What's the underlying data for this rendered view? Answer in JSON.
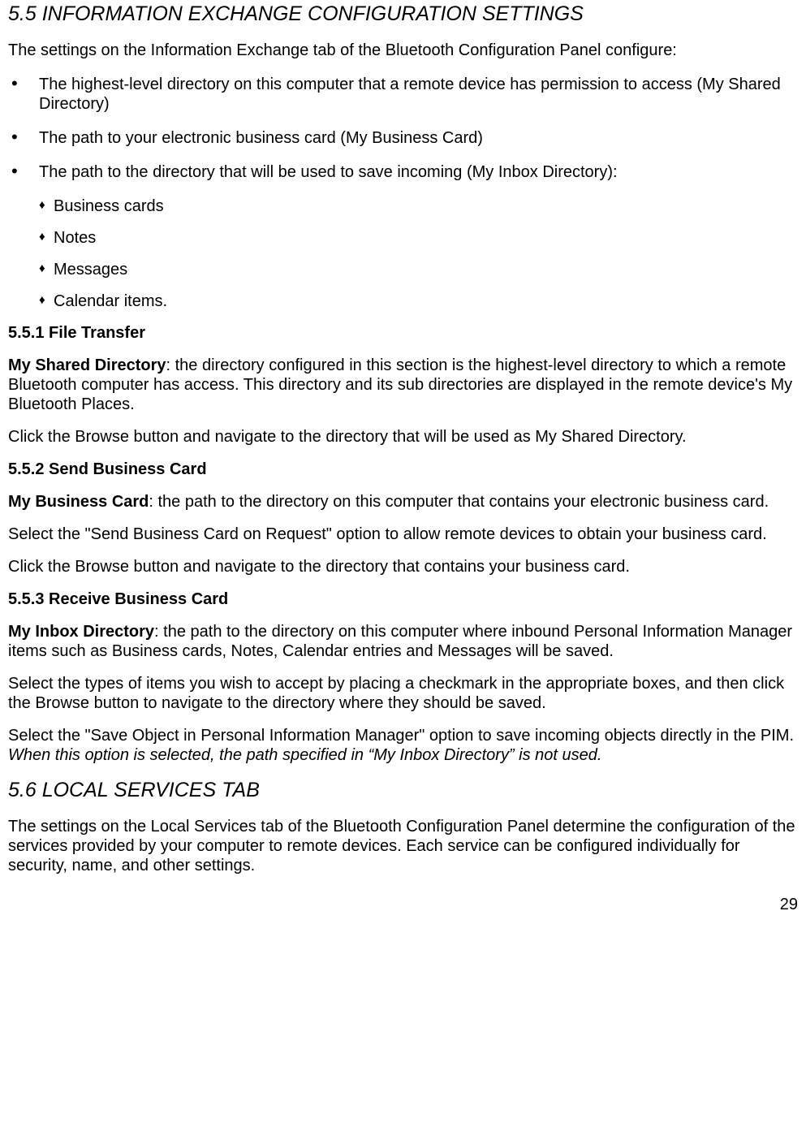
{
  "section55": {
    "heading": "5.5 INFORMATION EXCHANGE CONFIGURATION SETTINGS",
    "intro": "The settings on the Information Exchange tab of the Bluetooth Configuration Panel configure:",
    "bullets": [
      "The highest-level directory on this computer that a remote device has permission to access (My Shared Directory)",
      "The path to your electronic business card (My Business Card)",
      "The path to the directory that will be used to save incoming (My Inbox Directory):"
    ],
    "diamonds": [
      "Business cards",
      "Notes",
      "Messages",
      "Calendar items."
    ]
  },
  "section551": {
    "heading": "5.5.1 File Transfer",
    "lead": "My Shared Directory",
    "leadRest": ": the directory configured in this section is the highest-level directory to which a remote Bluetooth computer has access. This directory and its sub directories are displayed in the remote device's My Bluetooth Places.",
    "p2": "Click the Browse button and navigate to the directory that will be used as My Shared Directory."
  },
  "section552": {
    "heading": "5.5.2 Send Business Card",
    "lead": "My Business Card",
    "leadRest": ": the path to the directory on this computer that contains your electronic business card.",
    "p2": "Select the \"Send Business Card on Request\" option to allow remote devices to obtain your business card.",
    "p3": "Click the Browse button and navigate to the directory that contains your business card."
  },
  "section553": {
    "heading": "5.5.3 Receive Business Card",
    "lead": "My Inbox Directory",
    "leadRest": ": the path to the directory on this computer where inbound Personal Information Manager items such as Business cards, Notes, Calendar entries and Messages will be saved.",
    "p2": "Select the types of items you wish to accept by placing a checkmark in the appropriate boxes, and then click the Browse button to navigate to the directory where they should be saved.",
    "p3a": "Select the \"Save Object in Personal Information Manager\" option to save incoming objects directly in the PIM. ",
    "p3b": "When this option is selected, the path specified in “My Inbox Directory” is not used."
  },
  "section56": {
    "heading": "5.6 LOCAL SERVICES TAB",
    "p1": "The settings on the Local Services tab of the Bluetooth Configuration Panel determine the configuration of the services provided by your computer to remote devices. Each service can be configured individually for security, name, and other settings."
  },
  "pageNumber": "29"
}
